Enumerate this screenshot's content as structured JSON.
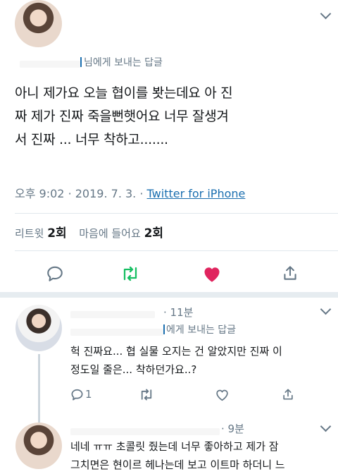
{
  "tweet": {
    "reply_to_suffix": "님에게 보내는 답글",
    "text_line1": "아니 제가요 오늘 협이를 봣는데요 아 진",
    "text_line2": "짜 제가 진짜 죽을뻔햇어요 너무 잘생겨",
    "text_line3": "서 진짜 ... 너무 착하고.......",
    "time": "오후 9:02",
    "sep1": "·",
    "date": "2019. 7. 3.",
    "sep2": "·",
    "source": "Twitter for iPhone",
    "retweet_label": "리트윗",
    "retweet_count": "2회",
    "like_label": "마음에 들어요",
    "like_count": "2회"
  },
  "reply1": {
    "time": "· 11분",
    "reply_to_suffix": "에게 보내는 답글",
    "text_line1": "헉 진짜요... 협 실물 오지는 건 알았지만 진짜 이",
    "text_line2": "정도일 줄은... 착하던가요..?",
    "reply_count": "1"
  },
  "reply2": {
    "time": "· 9분",
    "text_line1": "네네 ㅠㅠ 초콜릿 줬는데 너무 좋아하고 제가 잠",
    "text_line2": "그치면은 현이르 헤나는데 보고 이트마 하더니 느"
  },
  "colors": {
    "like": "#e0245e",
    "retweet": "#17bf63",
    "muted": "#657786",
    "link": "#1b6fb0"
  }
}
